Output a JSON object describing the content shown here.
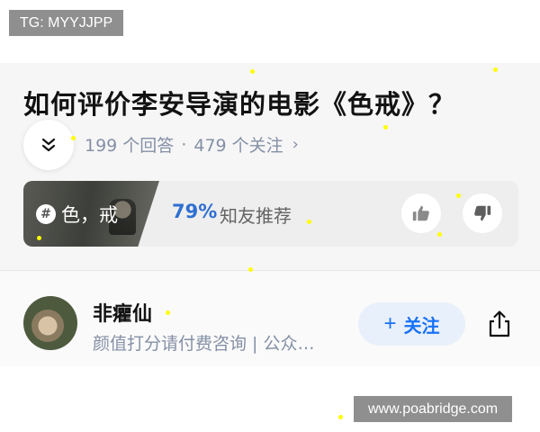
{
  "watermark_top": "TG: MYYJJPP",
  "watermark_bottom": "www.poabridge.com",
  "question": {
    "title": "如何评价李安导演的电影《色戒》？",
    "answers": "199 个回答",
    "separator": "·",
    "followers": "479 个关注",
    "chevron": "›"
  },
  "topic": {
    "hash": "#",
    "label": "色，戒",
    "recommend_pct": "79%",
    "recommend_text": "知友推荐"
  },
  "author": {
    "name": "非癯仙",
    "bio": "颜值打分请付费咨询 | 公众…",
    "follow_plus": "+",
    "follow_label": "关注"
  },
  "icons": [
    "collapse-double-chevron-icon",
    "hash-icon",
    "thumbs-up-icon",
    "thumbs-down-icon",
    "share-icon",
    "chevron-right-icon"
  ],
  "colors": {
    "accent": "#1772f6",
    "percent": "#2f6fd1",
    "muted": "#8590a6",
    "watermark_bg": "#8f8f8f"
  }
}
